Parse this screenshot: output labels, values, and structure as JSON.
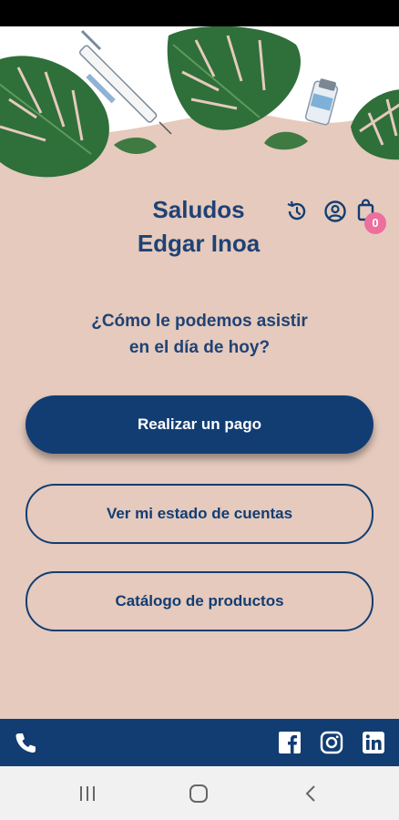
{
  "header": {
    "greeting_line1": "Saludos",
    "greeting_line2": "Edgar Inoa",
    "cart_count": "0"
  },
  "main": {
    "question_line1": "¿Cómo le podemos asistir",
    "question_line2": "en el día de hoy?",
    "buttons": {
      "pay": "Realizar un pago",
      "statement": "Ver mi estado de cuentas",
      "catalog": "Catálogo de productos"
    }
  },
  "icons": {
    "history": "history-icon",
    "profile": "user-circle-icon",
    "cart": "shopping-bag-icon",
    "phone": "phone-icon",
    "facebook": "facebook-icon",
    "instagram": "instagram-icon",
    "linkedin": "linkedin-icon"
  },
  "colors": {
    "background": "#e5cabd",
    "primary": "#123d72",
    "badge": "#ec6f9d"
  }
}
